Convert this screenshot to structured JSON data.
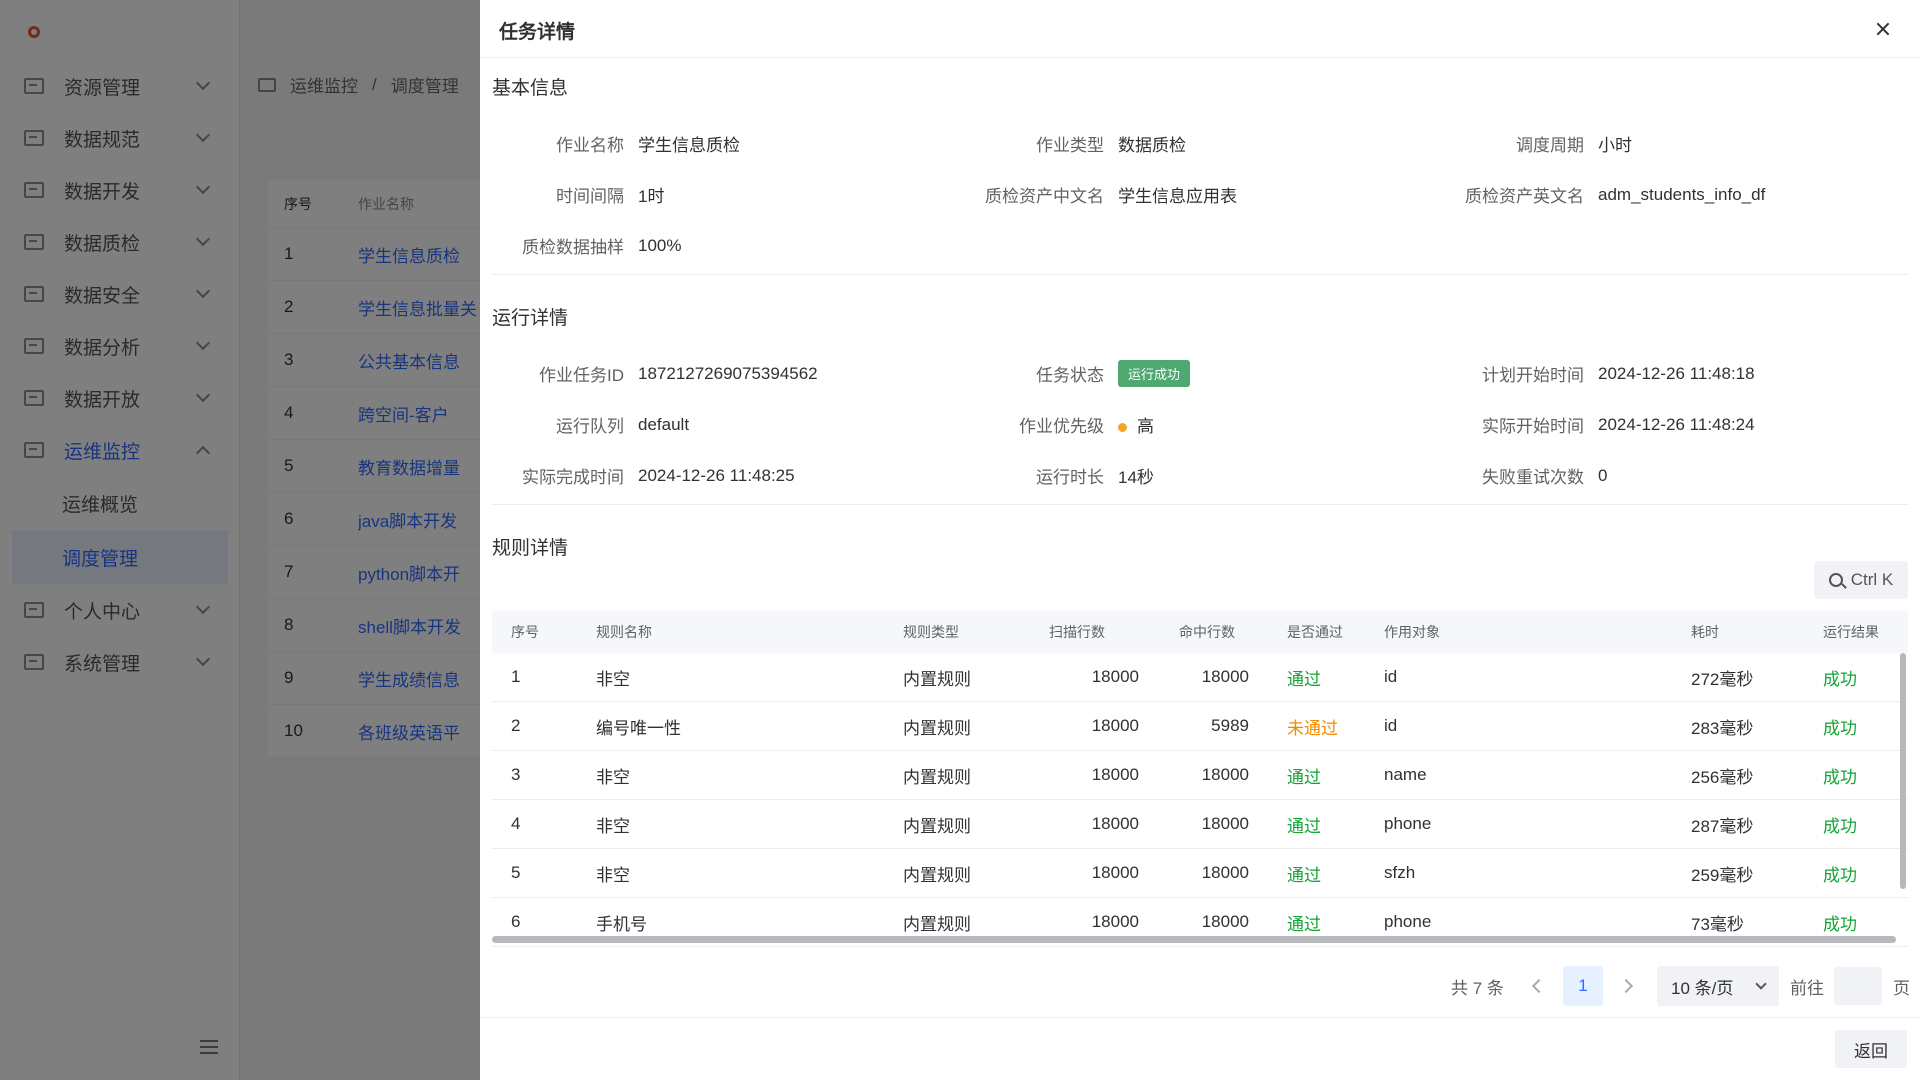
{
  "sidebar": {
    "items": [
      {
        "label": "资源管理"
      },
      {
        "label": "数据规范"
      },
      {
        "label": "数据开发"
      },
      {
        "label": "数据质检"
      },
      {
        "label": "数据安全"
      },
      {
        "label": "数据分析"
      },
      {
        "label": "数据开放"
      },
      {
        "label": "运维监控"
      },
      {
        "label": "个人中心"
      },
      {
        "label": "系统管理"
      }
    ],
    "sub_items": [
      {
        "label": "运维概览"
      },
      {
        "label": "调度管理"
      }
    ]
  },
  "breadcrumb": {
    "level1": "运维监控",
    "sep": "/",
    "level2": "调度管理"
  },
  "bg_table": {
    "headers": {
      "idx": "序号",
      "name": "作业名称"
    },
    "rows": [
      {
        "idx": "1",
        "name": "学生信息质检"
      },
      {
        "idx": "2",
        "name": "学生信息批量关"
      },
      {
        "idx": "3",
        "name": "公共基本信息"
      },
      {
        "idx": "4",
        "name": "跨空间-客户"
      },
      {
        "idx": "5",
        "name": "教育数据增量"
      },
      {
        "idx": "6",
        "name": "java脚本开发"
      },
      {
        "idx": "7",
        "name": "python脚本开"
      },
      {
        "idx": "8",
        "name": "shell脚本开发"
      },
      {
        "idx": "9",
        "name": "学生成绩信息"
      },
      {
        "idx": "10",
        "name": "各班级英语平"
      }
    ]
  },
  "drawer": {
    "title": "任务详情",
    "basic": {
      "section_title": "基本信息",
      "job_name_label": "作业名称",
      "job_name": "学生信息质检",
      "job_type_label": "作业类型",
      "job_type": "数据质检",
      "cycle_label": "调度周期",
      "cycle": "小时",
      "interval_label": "时间间隔",
      "interval": "1时",
      "asset_cn_label": "质检资产中文名",
      "asset_cn": "学生信息应用表",
      "asset_en_label": "质检资产英文名",
      "asset_en": "adm_students_info_df",
      "sampling_label": "质检数据抽样",
      "sampling": "100%"
    },
    "run": {
      "section_title": "运行详情",
      "task_id_label": "作业任务ID",
      "task_id": "1872127269075394562",
      "status_label": "任务状态",
      "status": "运行成功",
      "plan_start_label": "计划开始时间",
      "plan_start": "2024-12-26 11:48:18",
      "queue_label": "运行队列",
      "queue": "default",
      "priority_label": "作业优先级",
      "priority": "高",
      "actual_start_label": "实际开始时间",
      "actual_start": "2024-12-26 11:48:24",
      "actual_end_label": "实际完成时间",
      "actual_end": "2024-12-26 11:48:25",
      "duration_label": "运行时长",
      "duration": "14秒",
      "retry_label": "失败重试次数",
      "retry": "0"
    },
    "rules": {
      "section_title": "规则详情",
      "search_shortcut": "Ctrl K",
      "headers": {
        "idx": "序号",
        "name": "规则名称",
        "type": "规则类型",
        "scan": "扫描行数",
        "hit": "命中行数",
        "pass": "是否通过",
        "object": "作用对象",
        "time": "耗时",
        "result": "运行结果"
      },
      "rows": [
        {
          "idx": "1",
          "name": "非空",
          "type": "内置规则",
          "scan": "18000",
          "hit": "18000",
          "pass": "通过",
          "object": "id",
          "time": "272毫秒",
          "result": "成功"
        },
        {
          "idx": "2",
          "name": "编号唯一性",
          "type": "内置规则",
          "scan": "18000",
          "hit": "5989",
          "pass": "未通过",
          "object": "id",
          "time": "283毫秒",
          "result": "成功"
        },
        {
          "idx": "3",
          "name": "非空",
          "type": "内置规则",
          "scan": "18000",
          "hit": "18000",
          "pass": "通过",
          "object": "name",
          "time": "256毫秒",
          "result": "成功"
        },
        {
          "idx": "4",
          "name": "非空",
          "type": "内置规则",
          "scan": "18000",
          "hit": "18000",
          "pass": "通过",
          "object": "phone",
          "time": "287毫秒",
          "result": "成功"
        },
        {
          "idx": "5",
          "name": "非空",
          "type": "内置规则",
          "scan": "18000",
          "hit": "18000",
          "pass": "通过",
          "object": "sfzh",
          "time": "259毫秒",
          "result": "成功"
        },
        {
          "idx": "6",
          "name": "手机号",
          "type": "内置规则",
          "scan": "18000",
          "hit": "18000",
          "pass": "通过",
          "object": "phone",
          "time": "73毫秒",
          "result": "成功"
        }
      ]
    },
    "pagination": {
      "total": "共 7 条",
      "current": "1",
      "page_size": "10 条/页",
      "goto_label": "前往",
      "goto_value": "",
      "page_suffix": "页"
    },
    "back_label": "返回"
  },
  "colors": {
    "accent": "#2f6bff",
    "success_tag": "#4ea86f",
    "pass": "#13a436",
    "fail": "#f08c00",
    "priority_high": "#f5a623"
  }
}
